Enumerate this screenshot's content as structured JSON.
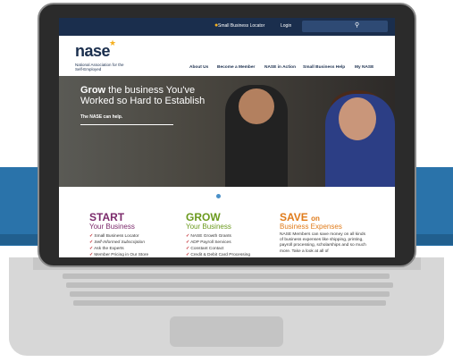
{
  "topbar": {
    "locator_label": "Small Business Locator",
    "login_label": "Login",
    "search_placeholder": ""
  },
  "brand": {
    "logo_text": "nase",
    "tagline": "National Association for the Self-Employed"
  },
  "nav": {
    "items": [
      "About Us",
      "Become a Member",
      "NASE in Action",
      "Small Business Help",
      "My NASE"
    ]
  },
  "hero": {
    "title_bold": "Grow",
    "title_rest": " the business You've Worked so Hard to Establish",
    "subtitle": "The NASE can help."
  },
  "columns": {
    "start": {
      "heading": "START",
      "subheading": "Your Business",
      "items": [
        "Small Business Locator",
        "Self-Informed Subscription",
        "Ask the Experts",
        "Member Pricing in Our Store",
        "Steps to Starting a Business"
      ]
    },
    "grow": {
      "heading": "GROW",
      "subheading": "Your Business",
      "items": [
        "NASE Growth Grants",
        "ADP Payroll Services",
        "Constant Contact",
        "Credit & Debit Card Processing",
        "with EAPS"
      ]
    },
    "save": {
      "heading": "SAVE",
      "heading_suffix": "on",
      "subheading": "Business Expenses",
      "body": "NASE Members can save money on all kinds of business expenses like shipping, printing, payroll processing, scholarships and so much more. Take a look at all of"
    }
  },
  "colors": {
    "navy": "#1a2e4d",
    "start": "#7b2a6b",
    "grow": "#6b9a1e",
    "save": "#e07b1a",
    "accent_gold": "#f5b020",
    "band_blue": "#2a73aa"
  }
}
